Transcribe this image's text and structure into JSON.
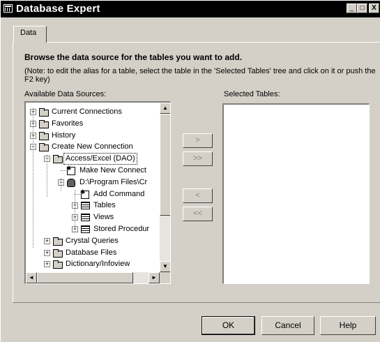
{
  "window": {
    "title": "Database Expert",
    "controls": {
      "minimize": "_",
      "maximize": "□",
      "close": "X"
    }
  },
  "tabs": [
    {
      "label": "Data",
      "selected": true
    }
  ],
  "instructions": {
    "heading": "Browse the data source for the tables you want to add.",
    "note": "(Note: to edit the alias for a table, select the table in the 'Selected Tables' tree and click on it or push the F2 key)"
  },
  "available": {
    "label": "Available Data Sources:",
    "tree": [
      {
        "label": "Current Connections",
        "icon": "folder-icon",
        "expander": "+",
        "level": 0
      },
      {
        "label": "Favorites",
        "icon": "folder-icon",
        "expander": "+",
        "level": 0
      },
      {
        "label": "History",
        "icon": "folder-icon",
        "expander": "+",
        "level": 0
      },
      {
        "label": "Create New Connection",
        "icon": "folder-icon",
        "expander": "−",
        "level": 0
      },
      {
        "label": "Access/Excel (DAO)",
        "icon": "folder-icon",
        "expander": "−",
        "level": 1,
        "selected": true
      },
      {
        "label": "Make New Connect",
        "icon": "database-new-icon",
        "expander": "",
        "level": 2
      },
      {
        "label": "D:\\Program Files\\Cr",
        "icon": "database-icon",
        "expander": "−",
        "level": 2
      },
      {
        "label": "Add Command",
        "icon": "command-icon",
        "expander": "",
        "level": 3
      },
      {
        "label": "Tables",
        "icon": "table-icon",
        "expander": "+",
        "level": 3
      },
      {
        "label": "Views",
        "icon": "table-icon",
        "expander": "+",
        "level": 3
      },
      {
        "label": "Stored Procedur",
        "icon": "table-icon",
        "expander": "+",
        "level": 3
      },
      {
        "label": "Crystal Queries",
        "icon": "folder-icon",
        "expander": "+",
        "level": 1
      },
      {
        "label": "Database Files",
        "icon": "folder-icon",
        "expander": "+",
        "level": 1
      },
      {
        "label": "Dictionary/Infoview",
        "icon": "folder-icon",
        "expander": "+",
        "level": 1
      }
    ]
  },
  "selected_tables": {
    "label": "Selected Tables:"
  },
  "move_buttons": [
    {
      "name": "add-selected-button",
      "label": ">"
    },
    {
      "name": "add-all-button",
      "label": ">>"
    },
    {
      "name": "remove-selected-button",
      "label": "<"
    },
    {
      "name": "remove-all-button",
      "label": "<<"
    }
  ],
  "footer": {
    "ok": "OK",
    "cancel": "Cancel",
    "help": "Help"
  },
  "scroll": {
    "up": "▲",
    "down": "▼",
    "left": "◄",
    "right": "►"
  }
}
